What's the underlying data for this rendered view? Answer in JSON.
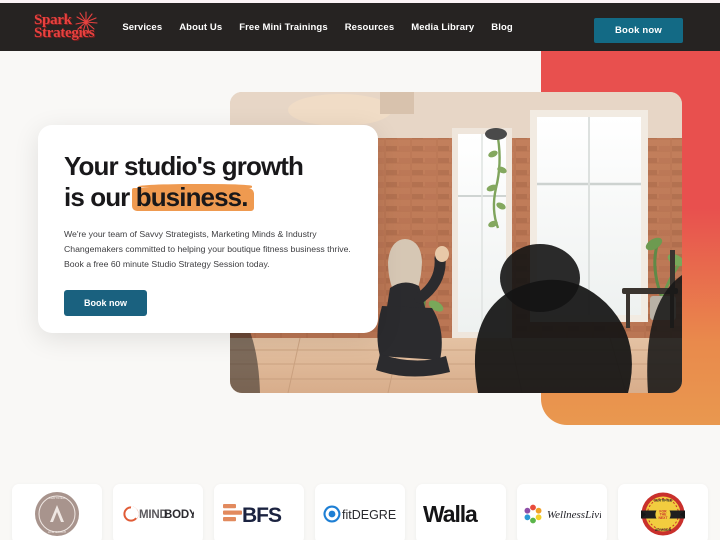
{
  "site": {
    "background_color": "#f9f8f6",
    "nav_background": "#262322",
    "brand_red": "#e8413f",
    "accent_orange": "#ef9a50",
    "cta_teal": "#136a85"
  },
  "navbar": {
    "logo": {
      "line1": "Spark",
      "line2": "Strategies",
      "icon": "starburst-icon"
    },
    "links": [
      {
        "label": "Services"
      },
      {
        "label": "About Us"
      },
      {
        "label": "Free Mini Trainings"
      },
      {
        "label": "Resources"
      },
      {
        "label": "Media Library"
      },
      {
        "label": "Blog"
      }
    ],
    "cta_label": "Book now"
  },
  "hero": {
    "title_line1": "Your studio's growth",
    "title_line2_prefix": "is our ",
    "title_line2_highlight": "business.",
    "body": "We're your team of Savvy Strategists, Marketing Minds & Industry Changemakers committed to helping your boutique fitness business thrive. Book a free 60 minute Studio Strategy Session today.",
    "cta_label": "Book now",
    "photo_alt": "fitness studio interior with brick wall, large windows and instructor"
  },
  "partner_logos": [
    {
      "name": "certified-wellness-life-coach-seal",
      "label": ""
    },
    {
      "name": "mindbody-logo",
      "label": "MINDBODY"
    },
    {
      "name": "bfs-logo",
      "label": "BFS"
    },
    {
      "name": "fitdegree-logo",
      "label": "fitDEGREE"
    },
    {
      "name": "walla-logo",
      "label": "Walla"
    },
    {
      "name": "wellnessliving-logo",
      "label": "WellnessLiving"
    },
    {
      "name": "certified-advisor-badge",
      "label": "CERTIFIED ADVISOR"
    }
  ]
}
